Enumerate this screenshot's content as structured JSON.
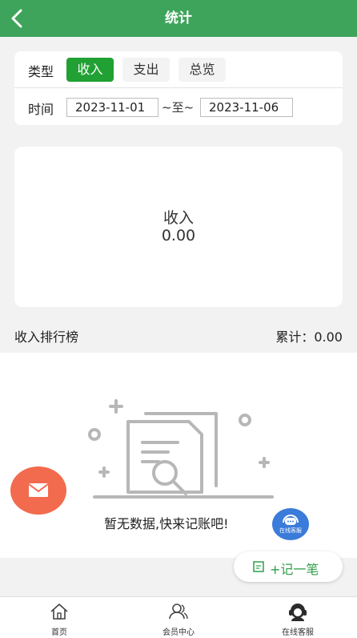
{
  "header": {
    "title": "统计"
  },
  "filter": {
    "type_label": "类型",
    "type_options": [
      "收入",
      "支出",
      "总览"
    ],
    "selected_type": "收入",
    "time_label": "时间",
    "start_date": "2023-11-01",
    "separator": "~至~",
    "end_date": "2023-11-06"
  },
  "summary": {
    "label": "收入",
    "value": "0.00"
  },
  "ranking": {
    "title": "收入排行榜",
    "total": "累计：0.00"
  },
  "empty": {
    "message": "暂无数据,快来记账吧!"
  },
  "service_fab": {
    "label": "在线客服"
  },
  "add_button": {
    "label": "+记一笔"
  },
  "tabbar": {
    "items": [
      {
        "label": "首页",
        "icon": "home-icon"
      },
      {
        "label": "会员中心",
        "icon": "users-icon"
      },
      {
        "label": "在线客服",
        "icon": "customer-service-icon"
      }
    ]
  },
  "colors": {
    "primary": "#3ea45b",
    "active_segment": "#21a033",
    "mail_fab": "#f26b4e",
    "service_fab": "#3b7bd9"
  }
}
